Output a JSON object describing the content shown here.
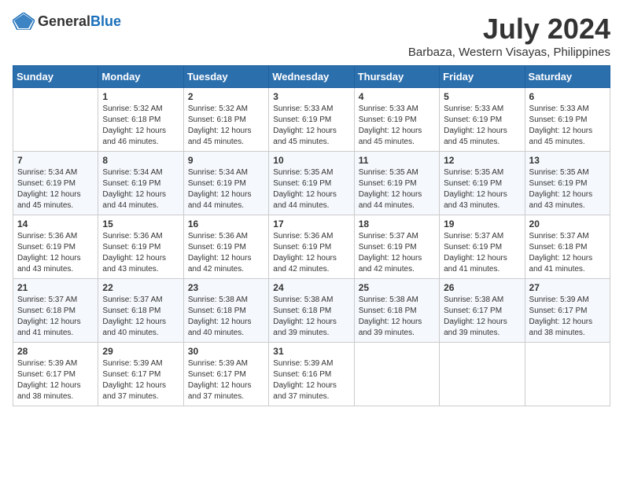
{
  "header": {
    "logo_general": "General",
    "logo_blue": "Blue",
    "month_year": "July 2024",
    "location": "Barbaza, Western Visayas, Philippines"
  },
  "weekdays": [
    "Sunday",
    "Monday",
    "Tuesday",
    "Wednesday",
    "Thursday",
    "Friday",
    "Saturday"
  ],
  "weeks": [
    [
      {
        "day": "",
        "info": ""
      },
      {
        "day": "1",
        "info": "Sunrise: 5:32 AM\nSunset: 6:18 PM\nDaylight: 12 hours and 46 minutes."
      },
      {
        "day": "2",
        "info": "Sunrise: 5:32 AM\nSunset: 6:18 PM\nDaylight: 12 hours and 45 minutes."
      },
      {
        "day": "3",
        "info": "Sunrise: 5:33 AM\nSunset: 6:19 PM\nDaylight: 12 hours and 45 minutes."
      },
      {
        "day": "4",
        "info": "Sunrise: 5:33 AM\nSunset: 6:19 PM\nDaylight: 12 hours and 45 minutes."
      },
      {
        "day": "5",
        "info": "Sunrise: 5:33 AM\nSunset: 6:19 PM\nDaylight: 12 hours and 45 minutes."
      },
      {
        "day": "6",
        "info": "Sunrise: 5:33 AM\nSunset: 6:19 PM\nDaylight: 12 hours and 45 minutes."
      }
    ],
    [
      {
        "day": "7",
        "info": "Sunrise: 5:34 AM\nSunset: 6:19 PM\nDaylight: 12 hours and 45 minutes."
      },
      {
        "day": "8",
        "info": "Sunrise: 5:34 AM\nSunset: 6:19 PM\nDaylight: 12 hours and 44 minutes."
      },
      {
        "day": "9",
        "info": "Sunrise: 5:34 AM\nSunset: 6:19 PM\nDaylight: 12 hours and 44 minutes."
      },
      {
        "day": "10",
        "info": "Sunrise: 5:35 AM\nSunset: 6:19 PM\nDaylight: 12 hours and 44 minutes."
      },
      {
        "day": "11",
        "info": "Sunrise: 5:35 AM\nSunset: 6:19 PM\nDaylight: 12 hours and 44 minutes."
      },
      {
        "day": "12",
        "info": "Sunrise: 5:35 AM\nSunset: 6:19 PM\nDaylight: 12 hours and 43 minutes."
      },
      {
        "day": "13",
        "info": "Sunrise: 5:35 AM\nSunset: 6:19 PM\nDaylight: 12 hours and 43 minutes."
      }
    ],
    [
      {
        "day": "14",
        "info": "Sunrise: 5:36 AM\nSunset: 6:19 PM\nDaylight: 12 hours and 43 minutes."
      },
      {
        "day": "15",
        "info": "Sunrise: 5:36 AM\nSunset: 6:19 PM\nDaylight: 12 hours and 43 minutes."
      },
      {
        "day": "16",
        "info": "Sunrise: 5:36 AM\nSunset: 6:19 PM\nDaylight: 12 hours and 42 minutes."
      },
      {
        "day": "17",
        "info": "Sunrise: 5:36 AM\nSunset: 6:19 PM\nDaylight: 12 hours and 42 minutes."
      },
      {
        "day": "18",
        "info": "Sunrise: 5:37 AM\nSunset: 6:19 PM\nDaylight: 12 hours and 42 minutes."
      },
      {
        "day": "19",
        "info": "Sunrise: 5:37 AM\nSunset: 6:19 PM\nDaylight: 12 hours and 41 minutes."
      },
      {
        "day": "20",
        "info": "Sunrise: 5:37 AM\nSunset: 6:18 PM\nDaylight: 12 hours and 41 minutes."
      }
    ],
    [
      {
        "day": "21",
        "info": "Sunrise: 5:37 AM\nSunset: 6:18 PM\nDaylight: 12 hours and 41 minutes."
      },
      {
        "day": "22",
        "info": "Sunrise: 5:37 AM\nSunset: 6:18 PM\nDaylight: 12 hours and 40 minutes."
      },
      {
        "day": "23",
        "info": "Sunrise: 5:38 AM\nSunset: 6:18 PM\nDaylight: 12 hours and 40 minutes."
      },
      {
        "day": "24",
        "info": "Sunrise: 5:38 AM\nSunset: 6:18 PM\nDaylight: 12 hours and 39 minutes."
      },
      {
        "day": "25",
        "info": "Sunrise: 5:38 AM\nSunset: 6:18 PM\nDaylight: 12 hours and 39 minutes."
      },
      {
        "day": "26",
        "info": "Sunrise: 5:38 AM\nSunset: 6:17 PM\nDaylight: 12 hours and 39 minutes."
      },
      {
        "day": "27",
        "info": "Sunrise: 5:39 AM\nSunset: 6:17 PM\nDaylight: 12 hours and 38 minutes."
      }
    ],
    [
      {
        "day": "28",
        "info": "Sunrise: 5:39 AM\nSunset: 6:17 PM\nDaylight: 12 hours and 38 minutes."
      },
      {
        "day": "29",
        "info": "Sunrise: 5:39 AM\nSunset: 6:17 PM\nDaylight: 12 hours and 37 minutes."
      },
      {
        "day": "30",
        "info": "Sunrise: 5:39 AM\nSunset: 6:17 PM\nDaylight: 12 hours and 37 minutes."
      },
      {
        "day": "31",
        "info": "Sunrise: 5:39 AM\nSunset: 6:16 PM\nDaylight: 12 hours and 37 minutes."
      },
      {
        "day": "",
        "info": ""
      },
      {
        "day": "",
        "info": ""
      },
      {
        "day": "",
        "info": ""
      }
    ]
  ]
}
